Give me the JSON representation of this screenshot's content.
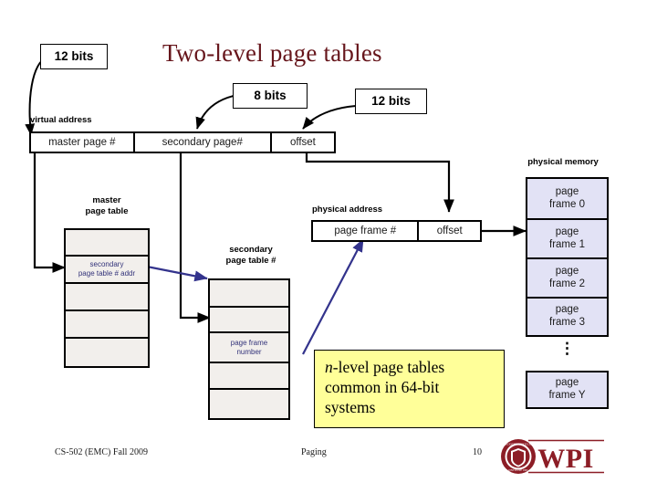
{
  "slide": {
    "title": "Two-level page tables",
    "title_color": "#66151b"
  },
  "callouts": [
    {
      "name": "master-bits",
      "label": "12 bits"
    },
    {
      "name": "secondary-bits",
      "label": "8 bits"
    },
    {
      "name": "offset-bits",
      "label": "12 bits"
    }
  ],
  "virtual_address": {
    "caption": "virtual address",
    "fields": [
      {
        "label": "master page #"
      },
      {
        "label": "secondary page#"
      },
      {
        "label": "offset"
      }
    ]
  },
  "physical_address": {
    "caption": "physical address",
    "fields": [
      {
        "label": "page frame #"
      },
      {
        "label": "offset"
      }
    ]
  },
  "master_page_table": {
    "caption_line1": "master",
    "caption_line2": "page table",
    "entries": [
      {
        "line1": "",
        "line2": ""
      },
      {
        "line1": "secondary",
        "line2": "page table # addr"
      },
      {
        "line1": "",
        "line2": ""
      },
      {
        "line1": "",
        "line2": ""
      },
      {
        "line1": "",
        "line2": ""
      }
    ]
  },
  "secondary_page_table": {
    "caption_line1": "secondary",
    "caption_line2": "page table #",
    "entries": [
      {
        "line1": "",
        "line2": ""
      },
      {
        "line1": "",
        "line2": ""
      },
      {
        "line1": "page frame",
        "line2": "number"
      },
      {
        "line1": "",
        "line2": ""
      },
      {
        "line1": "",
        "line2": ""
      }
    ]
  },
  "physical_memory": {
    "caption": "physical memory",
    "frames": [
      {
        "line1": "page",
        "line2": "frame 0"
      },
      {
        "line1": "page",
        "line2": "frame 1"
      },
      {
        "line1": "page",
        "line2": "frame 2"
      },
      {
        "line1": "page",
        "line2": "frame 3"
      }
    ],
    "ellipsis": "⋮",
    "last_frame": {
      "line1": "page",
      "line2": "frame Y"
    }
  },
  "note": {
    "line1_prefix": "n",
    "line1_rest": "-level page tables",
    "line2": "common in 64-bit",
    "line3": "systems",
    "background": "#ffff99"
  },
  "footer": {
    "course": "CS-502 (EMC) Fall 2009",
    "topic": "Paging",
    "page_number": "10",
    "logo_text": "WPI"
  },
  "colors": {
    "table_fill": "#f2efec",
    "memory_fill": "#e2e2f5",
    "entry_text": "#33337a",
    "pointer_arrow": "#33338c"
  }
}
